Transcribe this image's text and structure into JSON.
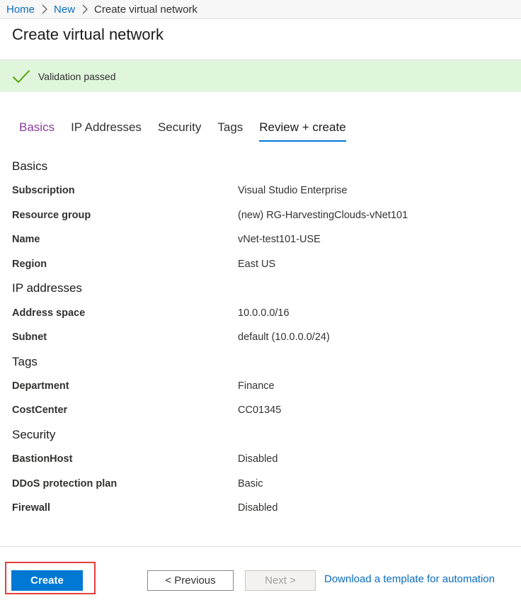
{
  "breadcrumb": {
    "items": [
      {
        "label": "Home"
      },
      {
        "label": "New"
      }
    ],
    "current": "Create virtual network"
  },
  "page": {
    "title": "Create virtual network"
  },
  "validation": {
    "message": "Validation passed",
    "color": "#dff6dd",
    "icon": "checkmark-icon"
  },
  "tabs": [
    {
      "label": "Basics",
      "state": "visited"
    },
    {
      "label": "IP Addresses",
      "state": "default"
    },
    {
      "label": "Security",
      "state": "default"
    },
    {
      "label": "Tags",
      "state": "default"
    },
    {
      "label": "Review + create",
      "state": "active"
    }
  ],
  "summary": {
    "basics": {
      "title": "Basics",
      "rows": [
        {
          "label": "Subscription",
          "value": "Visual Studio Enterprise"
        },
        {
          "label": "Resource group",
          "value": "(new) RG-HarvestingClouds-vNet101"
        },
        {
          "label": "Name",
          "value": "vNet-test101-USE"
        },
        {
          "label": "Region",
          "value": "East US"
        }
      ]
    },
    "ip": {
      "title": "IP addresses",
      "rows": [
        {
          "label": "Address space",
          "value": "10.0.0.0/16"
        },
        {
          "label": "Subnet",
          "value": "default (10.0.0.0/24)"
        }
      ]
    },
    "tags": {
      "title": "Tags",
      "rows": [
        {
          "label": "Department",
          "value": "Finance"
        },
        {
          "label": "CostCenter",
          "value": "CC01345"
        }
      ]
    },
    "security": {
      "title": "Security",
      "rows": [
        {
          "label": "BastionHost",
          "value": "Disabled"
        },
        {
          "label": "DDoS protection plan",
          "value": "Basic"
        },
        {
          "label": "Firewall",
          "value": "Disabled"
        }
      ]
    }
  },
  "footer": {
    "create_label": "Create",
    "previous_label": "< Previous",
    "next_label": "Next >",
    "download_label": "Download a template for automation"
  },
  "colors": {
    "accent": "#0078d4",
    "link": "#0b6cbd",
    "highlight": "#e53d3d"
  }
}
